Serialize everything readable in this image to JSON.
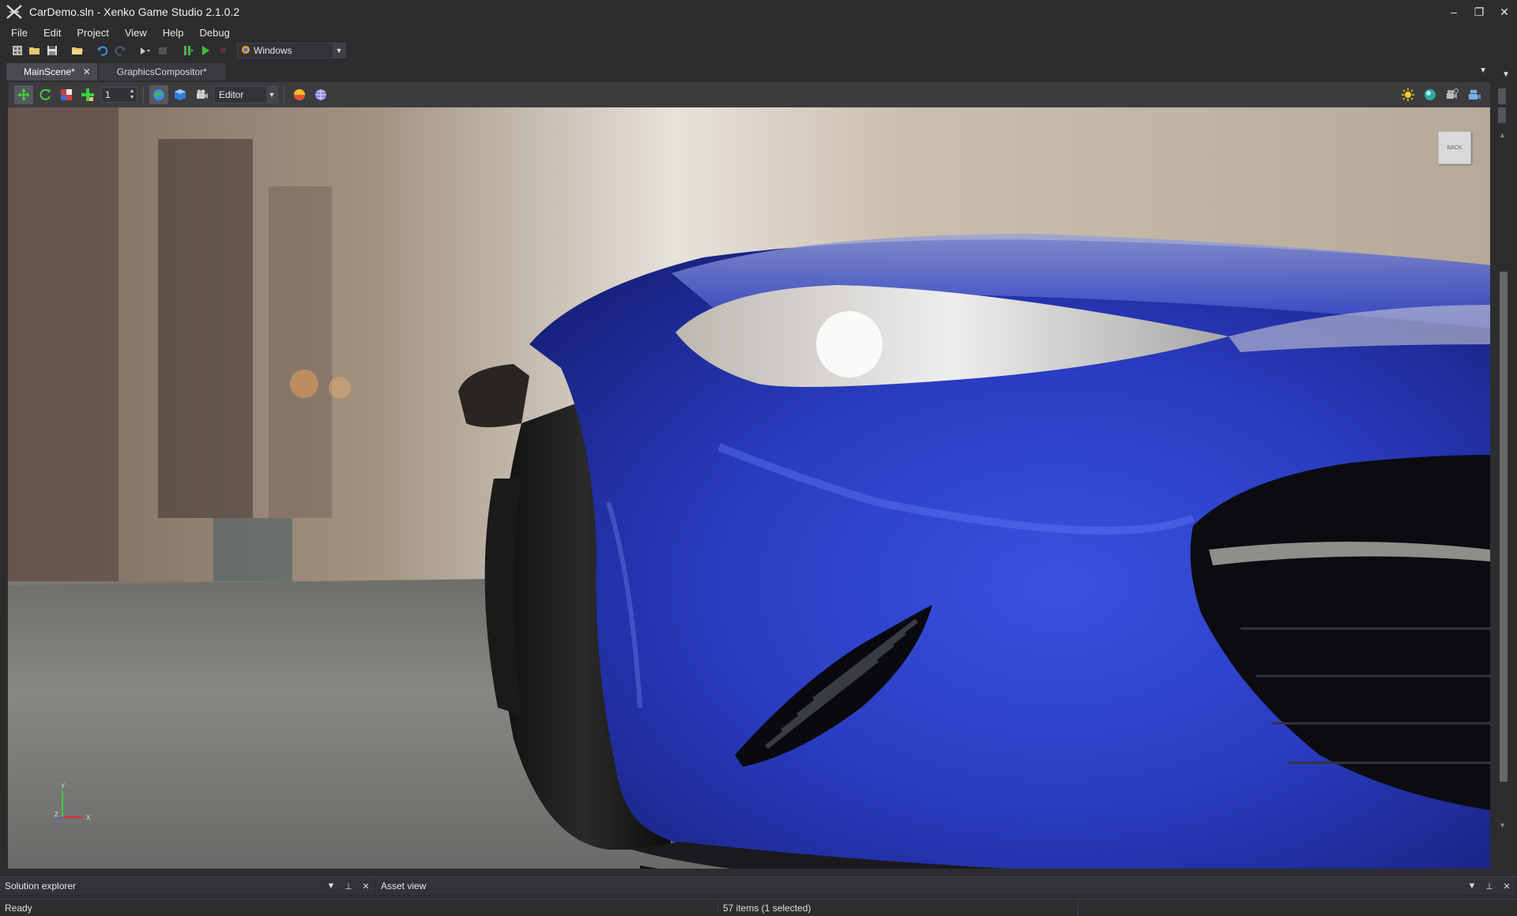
{
  "window": {
    "title": "CarDemo.sln - Xenko Game Studio 2.1.0.2",
    "controls": {
      "minimize": "–",
      "restore": "❐",
      "close": "✕"
    }
  },
  "menu": {
    "items": [
      "File",
      "Edit",
      "Project",
      "View",
      "Help",
      "Debug"
    ]
  },
  "toolbar": {
    "platform": "Windows",
    "icons": [
      "new-project-icon",
      "open-icon",
      "save-icon",
      "open-folder-icon",
      "undo-icon",
      "redo-icon",
      "package-icon",
      "build-icon",
      "run-icon",
      "stop-icon"
    ]
  },
  "tabs": [
    {
      "label": "MainScene*",
      "active": true
    },
    {
      "label": "GraphicsCompositor*",
      "active": false
    }
  ],
  "scene_toolbar": {
    "snap_value": "1",
    "camera_mode": "Editor",
    "right_icons": [
      "lighting-icon",
      "material-icon",
      "camera-gizmo-icon",
      "camera-preview-icon"
    ]
  },
  "viewport": {
    "nav_cube_label": "BACK",
    "axes": {
      "x": "X",
      "y": "Y",
      "z": "Z"
    },
    "colors": {
      "car_body": "#2a3fc6",
      "ground": "#7c7b79",
      "background_wall": "#a59a8c"
    }
  },
  "panels": {
    "solution_explorer": "Solution explorer",
    "asset_view": "Asset view"
  },
  "status": {
    "left": "Ready",
    "items": "57 items (1 selected)"
  }
}
